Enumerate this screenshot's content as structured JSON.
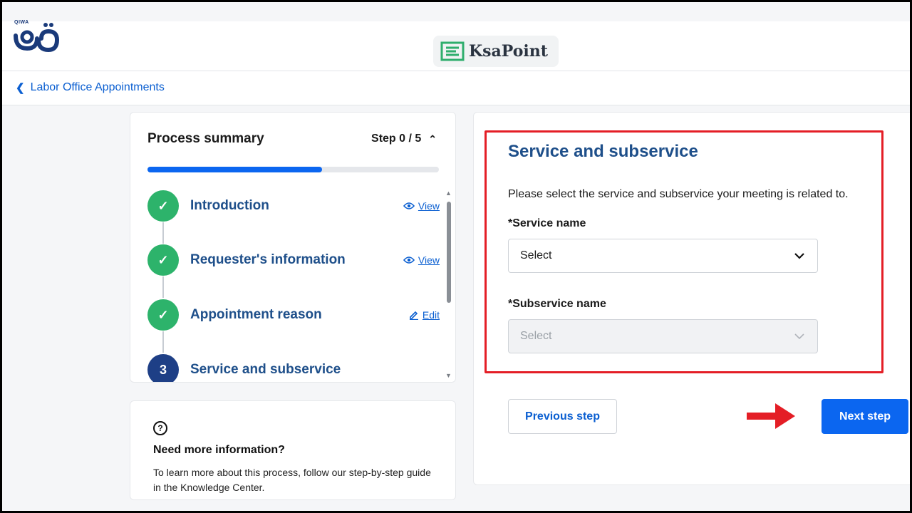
{
  "brand": {
    "logo_small_text": "QIWA",
    "watermark_text": "KsaPoint"
  },
  "nav": {
    "back_label": "Labor Office Appointments"
  },
  "summary": {
    "title": "Process summary",
    "step_count": "Step 0 / 5",
    "progress_fraction": 0.6,
    "steps": [
      {
        "number": "",
        "label": "Introduction",
        "status": "done",
        "action": "View",
        "action_icon": "eye-icon"
      },
      {
        "number": "",
        "label": "Requester's information",
        "status": "done",
        "action": "View",
        "action_icon": "eye-icon"
      },
      {
        "number": "",
        "label": "Appointment reason",
        "status": "done",
        "action": "Edit",
        "action_icon": "pencil-icon"
      },
      {
        "number": "3",
        "label": "Service and subservice",
        "status": "current",
        "action": "",
        "action_icon": ""
      }
    ]
  },
  "info": {
    "title": "Need more information?",
    "text": "To learn more about this process, follow our step-by-step guide in the Knowledge Center."
  },
  "form": {
    "title": "Service and subservice",
    "description": "Please select the service and subservice your meeting is related to.",
    "service_label": "*Service name",
    "service_value": "Select",
    "subservice_label": "*Subservice name",
    "subservice_value": "Select",
    "previous_label": "Previous step",
    "next_label": "Next step"
  },
  "colors": {
    "primary": "#0b66f0",
    "heading": "#1e4f8a",
    "success": "#2db36b",
    "highlight": "#e41e26"
  }
}
